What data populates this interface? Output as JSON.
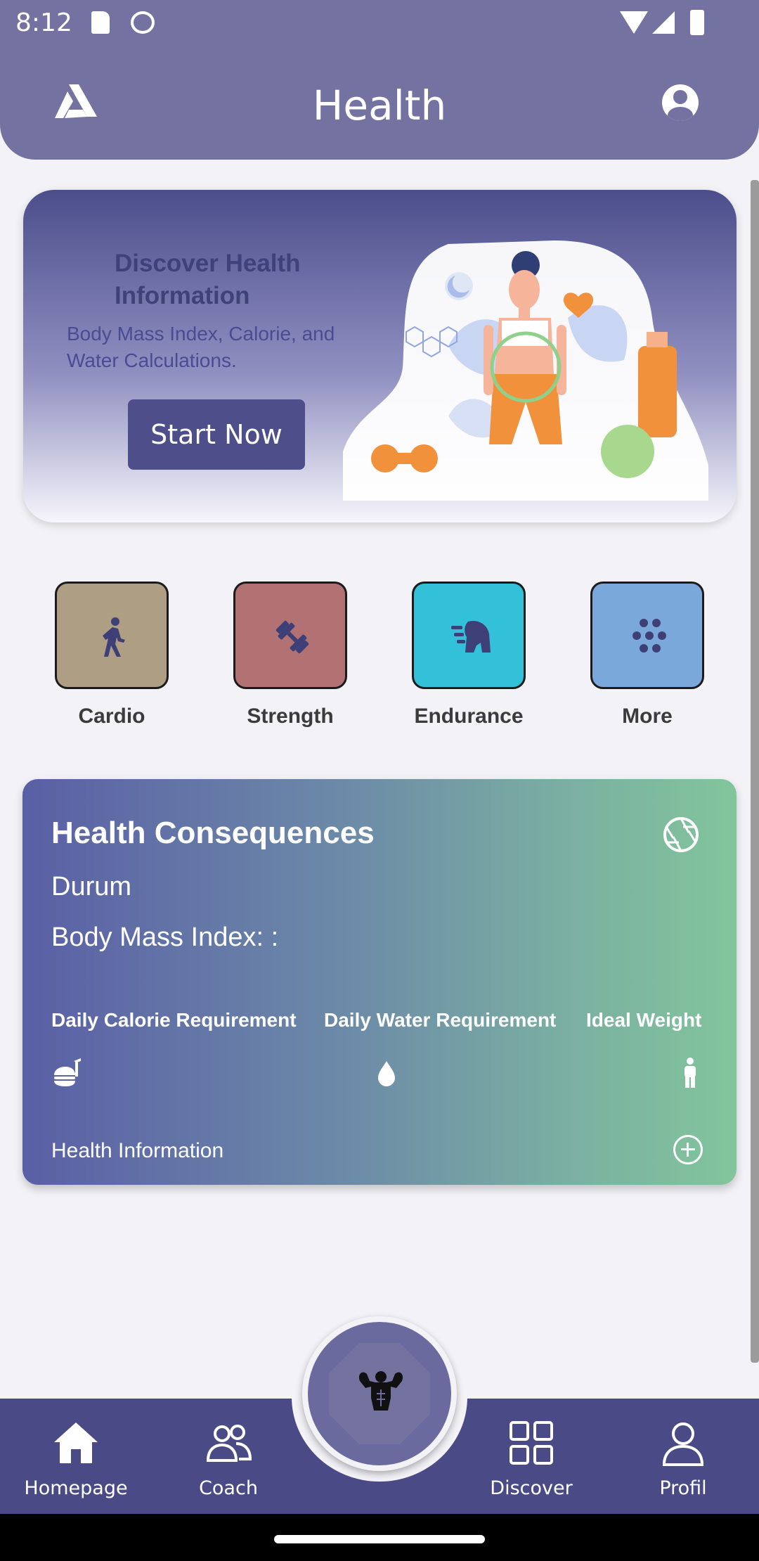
{
  "status_bar": {
    "time": "8:12"
  },
  "app_bar": {
    "title": "Health"
  },
  "hero": {
    "title": "Discover Health Information",
    "subtitle": "Body Mass Index, Calorie, and Water Calculations.",
    "button": "Start Now"
  },
  "categories": [
    {
      "label": "Cardio",
      "color": "#ad9e84",
      "icon": "walking-icon"
    },
    {
      "label": "Strength",
      "color": "#b27273",
      "icon": "dumbbell-icon"
    },
    {
      "label": "Endurance",
      "color": "#33c1d9",
      "icon": "horse-icon"
    },
    {
      "label": "More",
      "color": "#7ba8db",
      "icon": "dots-icon"
    }
  ],
  "consequences": {
    "title": "Health Consequences",
    "status": "Durum",
    "bmi": "Body Mass Index:  :",
    "columns": [
      "Daily Calorie Requirement",
      "Daily Water Requirement",
      "Ideal Weight"
    ],
    "info": "Health Information"
  },
  "bottom_nav": [
    "Homepage",
    "Coach",
    "Discover",
    "Profil"
  ]
}
